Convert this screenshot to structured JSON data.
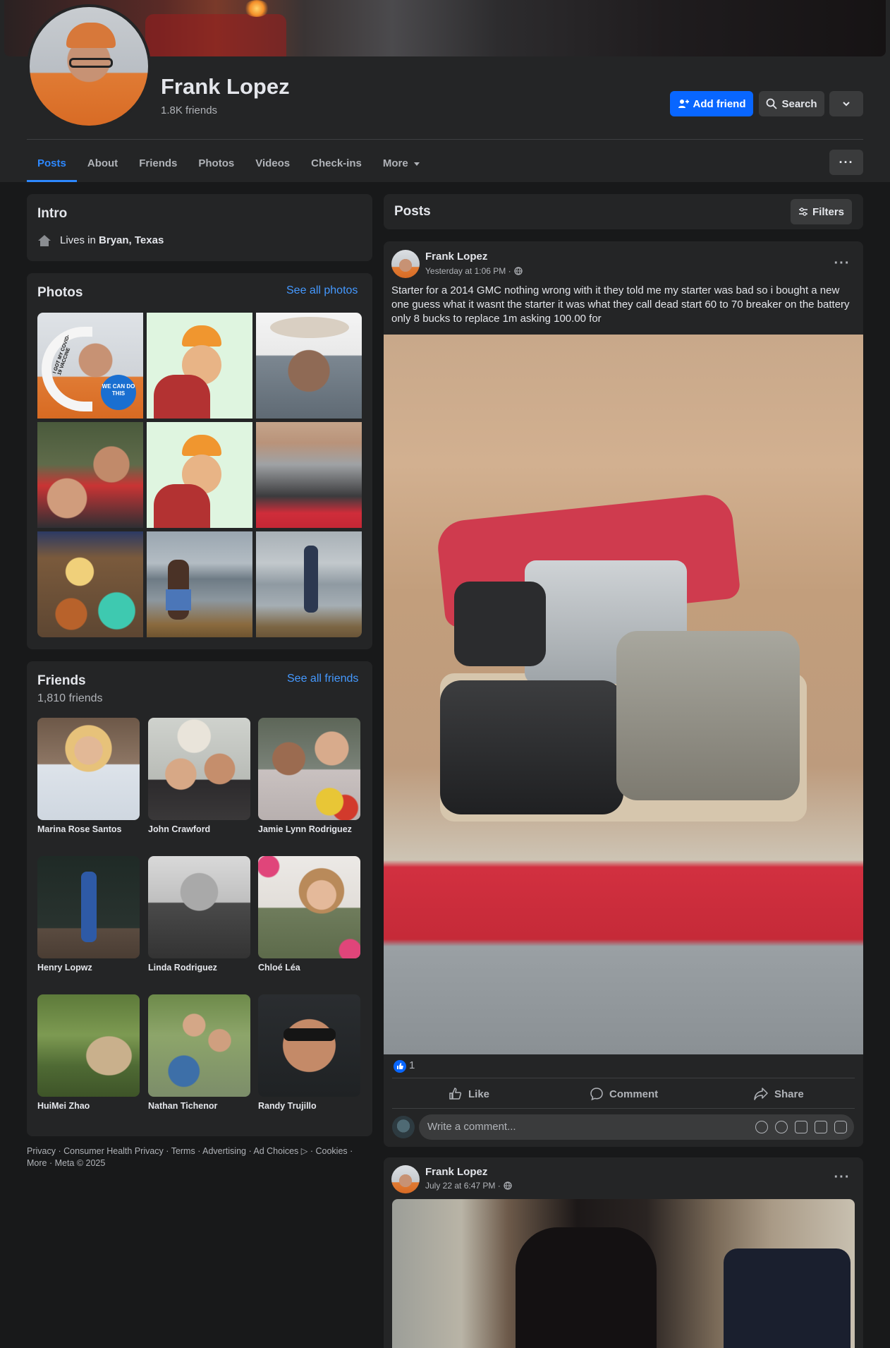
{
  "profile": {
    "name": "Frank Lopez",
    "friend_count": "1.8K friends"
  },
  "header_buttons": {
    "add_friend": "Add friend",
    "search": "Search"
  },
  "tabs": [
    {
      "label": "Posts",
      "active": true
    },
    {
      "label": "About"
    },
    {
      "label": "Friends"
    },
    {
      "label": "Photos"
    },
    {
      "label": "Videos"
    },
    {
      "label": "Check-ins"
    },
    {
      "label": "More"
    }
  ],
  "intro": {
    "title": "Intro",
    "lives_prefix": "Lives in ",
    "lives_place": "Bryan, Texas"
  },
  "photos": {
    "title": "Photos",
    "see_all": "See all photos",
    "sticker_text": "I GOT MY COVID-19 VACCINE",
    "badge_text": "WE CAN DO THIS"
  },
  "friends": {
    "title": "Friends",
    "count": "1,810 friends",
    "see_all": "See all friends",
    "list": [
      {
        "name": "Marina Rose Santos"
      },
      {
        "name": "John Crawford"
      },
      {
        "name": "Jamie Lynn Rodriguez"
      },
      {
        "name": "Henry Lopwz"
      },
      {
        "name": "Linda Rodriguez"
      },
      {
        "name": "Chloé Léa"
      },
      {
        "name": "HuiMei Zhao"
      },
      {
        "name": "Nathan Tichenor"
      },
      {
        "name": "Randy Trujillo"
      }
    ]
  },
  "footer": {
    "text": "Privacy · Consumer Health Privacy · Terms · Advertising · Ad Choices ▷ · Cookies · More · Meta © 2025"
  },
  "posts_header": {
    "title": "Posts",
    "filters": "Filters"
  },
  "post1": {
    "author": "Frank Lopez",
    "time": "Yesterday at 1:06 PM ·",
    "text": "Starter for a 2014 GMC nothing wrong with it they told me my starter was bad so i bought a new one guess what it wasnt the starter it was what they call dead start 60 to 70 breaker on the battery only 8 bucks to replace 1m asking 100.00 for",
    "reaction_count": "1",
    "like": "Like",
    "comment": "Comment",
    "share": "Share",
    "comment_placeholder": "Write a comment..."
  },
  "post2": {
    "author": "Frank Lopez",
    "time": "July 22 at 6:47 PM ·"
  },
  "colors": {
    "background": "#18191a",
    "card": "#242526",
    "accent_blue": "#0866ff",
    "link_blue": "#4599ff"
  }
}
